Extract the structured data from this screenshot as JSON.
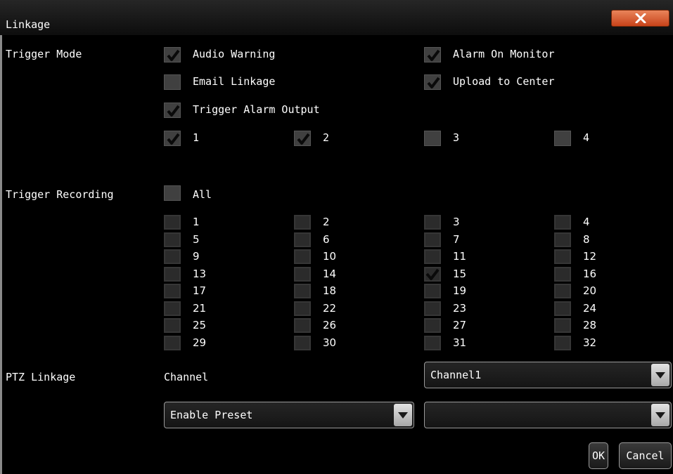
{
  "window": {
    "title": "Linkage"
  },
  "trigger_mode": {
    "label": "Trigger Mode",
    "audio_warning": {
      "label": "Audio Warning",
      "checked": true
    },
    "alarm_on_monitor": {
      "label": "Alarm On Monitor",
      "checked": true
    },
    "email_linkage": {
      "label": "Email Linkage",
      "checked": false
    },
    "upload_to_center": {
      "label": "Upload to Center",
      "checked": true
    },
    "trigger_alarm_output": {
      "label": "Trigger Alarm Output",
      "checked": true
    },
    "outputs": [
      {
        "label": "1",
        "checked": true
      },
      {
        "label": "2",
        "checked": true
      },
      {
        "label": "3",
        "checked": false
      },
      {
        "label": "4",
        "checked": false
      }
    ]
  },
  "trigger_recording": {
    "label": "Trigger Recording",
    "all": {
      "label": "All",
      "checked": false
    },
    "channels": [
      {
        "label": "1",
        "checked": false
      },
      {
        "label": "2",
        "checked": false
      },
      {
        "label": "3",
        "checked": false
      },
      {
        "label": "4",
        "checked": false
      },
      {
        "label": "5",
        "checked": false
      },
      {
        "label": "6",
        "checked": false
      },
      {
        "label": "7",
        "checked": false
      },
      {
        "label": "8",
        "checked": false
      },
      {
        "label": "9",
        "checked": false
      },
      {
        "label": "10",
        "checked": false
      },
      {
        "label": "11",
        "checked": false
      },
      {
        "label": "12",
        "checked": false
      },
      {
        "label": "13",
        "checked": false
      },
      {
        "label": "14",
        "checked": false
      },
      {
        "label": "15",
        "checked": true
      },
      {
        "label": "16",
        "checked": false
      },
      {
        "label": "17",
        "checked": false
      },
      {
        "label": "18",
        "checked": false
      },
      {
        "label": "19",
        "checked": false
      },
      {
        "label": "20",
        "checked": false
      },
      {
        "label": "21",
        "checked": false
      },
      {
        "label": "22",
        "checked": false
      },
      {
        "label": "23",
        "checked": false
      },
      {
        "label": "24",
        "checked": false
      },
      {
        "label": "25",
        "checked": false
      },
      {
        "label": "26",
        "checked": false
      },
      {
        "label": "27",
        "checked": false
      },
      {
        "label": "28",
        "checked": false
      },
      {
        "label": "29",
        "checked": false
      },
      {
        "label": "30",
        "checked": false
      },
      {
        "label": "31",
        "checked": false
      },
      {
        "label": "32",
        "checked": false
      }
    ]
  },
  "ptz_linkage": {
    "label": "PTZ Linkage",
    "channel_label": "Channel",
    "channel_value": "Channel1",
    "preset_mode_value": "Enable Preset",
    "preset_value": ""
  },
  "buttons": {
    "ok": "OK",
    "cancel": "Cancel"
  },
  "colors": {
    "close_button": "#d75a2c",
    "checkbox": "#404040",
    "background": "#000000"
  }
}
